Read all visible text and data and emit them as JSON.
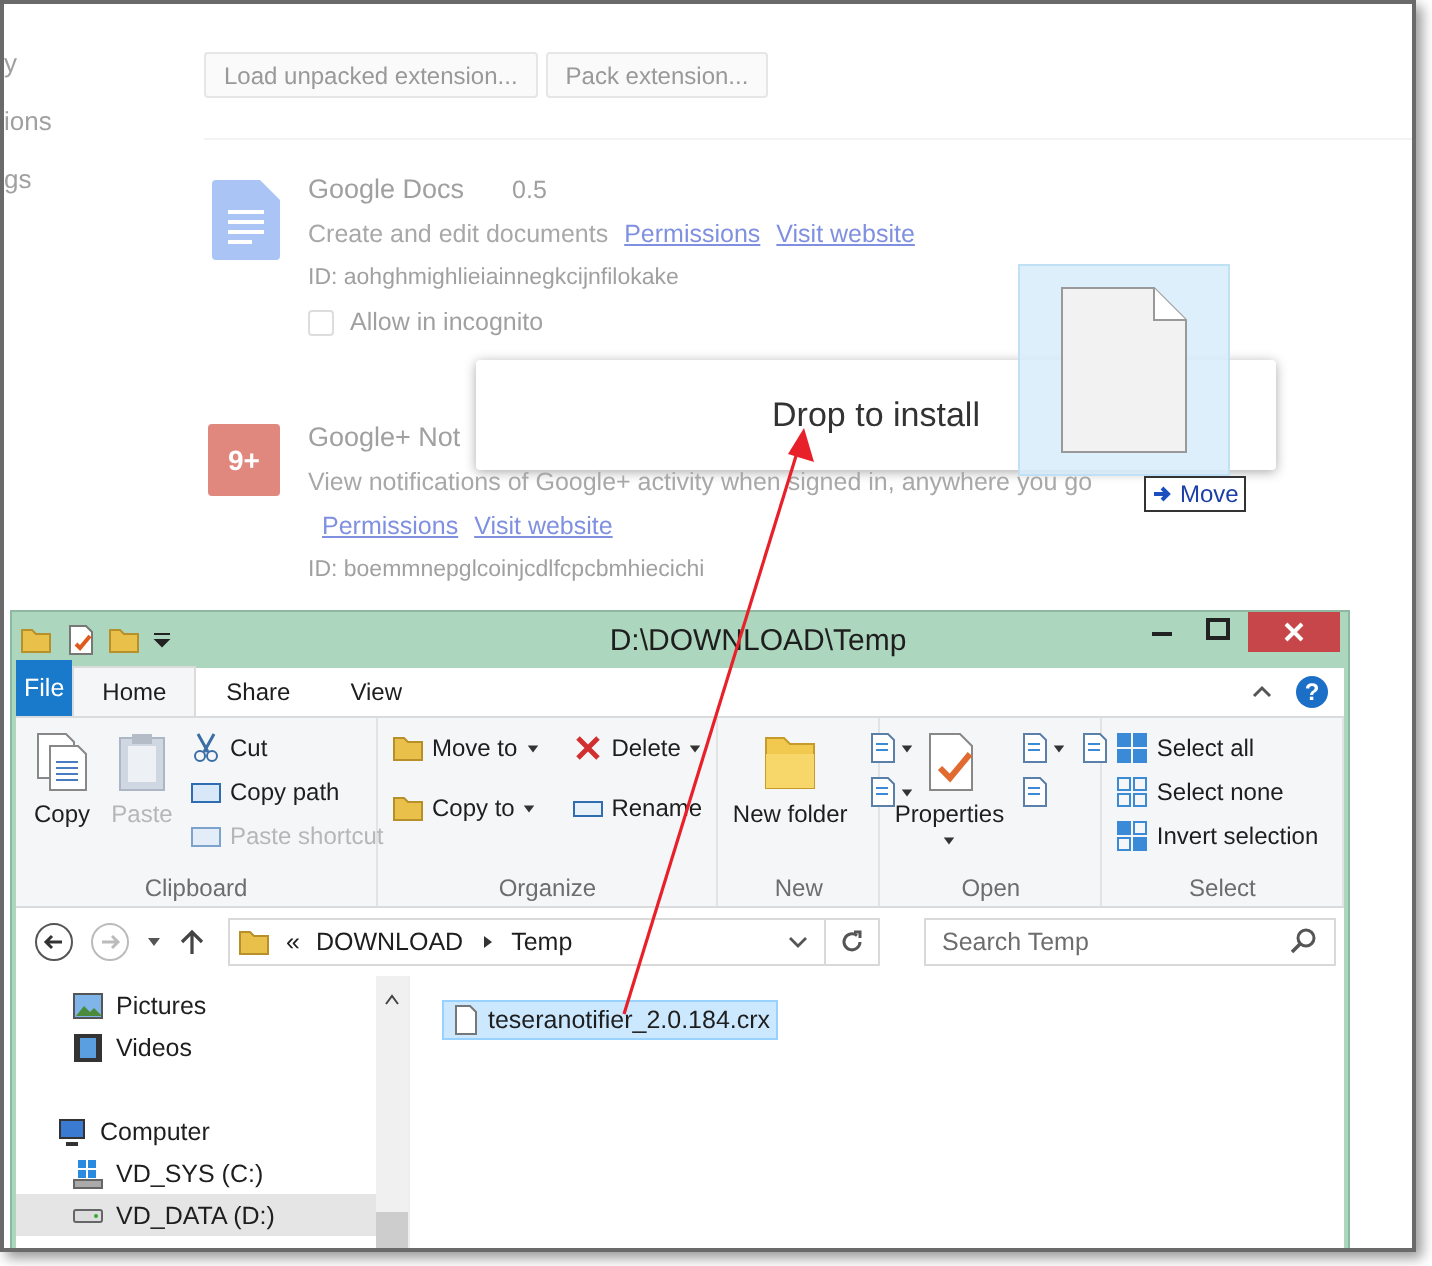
{
  "extensions_page": {
    "sidebar_items": [
      "y",
      "ions",
      "gs"
    ],
    "buttons": [
      "Load unpacked extension...",
      "Pack extension..."
    ],
    "extensions": [
      {
        "name": "Google Docs",
        "version": "0.5",
        "description": "Create and edit documents",
        "links": [
          "Permissions",
          "Visit website"
        ],
        "id": "ID: aohghmighlieiainnegkcijnfilokake",
        "incognito": {
          "label": "Allow in incognito",
          "checked": false
        }
      },
      {
        "name": "Google+ Not",
        "badge": "9+",
        "description": "View notifications of Google+ activity when signed in, anywhere you go",
        "links": [
          "Permissions",
          "Visit website"
        ],
        "id": "ID: boemmnepglcoinjcdlfcpcbmhiecichi"
      }
    ]
  },
  "drop_overlay": {
    "label": "Drop to install"
  },
  "drag": {
    "effect": "Move"
  },
  "explorer": {
    "title": "D:\\DOWNLOAD\\Temp",
    "help": "?",
    "tabs": [
      {
        "label": "File",
        "kind": "file",
        "selected": false
      },
      {
        "label": "Home",
        "kind": "tab",
        "selected": true
      },
      {
        "label": "Share",
        "kind": "tab",
        "selected": false
      },
      {
        "label": "View",
        "kind": "tab",
        "selected": false
      }
    ],
    "groups": [
      {
        "label": "Clipboard",
        "items": [
          {
            "label": "Copy",
            "kind": "large",
            "disabled": false
          },
          {
            "label": "Paste",
            "kind": "large",
            "disabled": true
          },
          {
            "label": "Cut",
            "kind": "small",
            "disabled": false
          },
          {
            "label": "Copy path",
            "kind": "small",
            "disabled": false
          },
          {
            "label": "Paste shortcut",
            "kind": "small",
            "disabled": true
          }
        ]
      },
      {
        "label": "Organize",
        "items": [
          {
            "label": "Move to",
            "kind": "small",
            "dropdown": true,
            "disabled": false
          },
          {
            "label": "Copy to",
            "kind": "small",
            "dropdown": true,
            "disabled": false
          },
          {
            "label": "Delete",
            "kind": "small",
            "dropdown": true,
            "disabled": false
          },
          {
            "label": "Rename",
            "kind": "small",
            "dropdown": false,
            "disabled": false
          }
        ]
      },
      {
        "label": "New",
        "items": [
          {
            "label": "New folder",
            "kind": "large",
            "dropdown": false,
            "disabled": false
          },
          {
            "kind": "iconbutton",
            "dropdown": true,
            "disabled": false
          },
          {
            "kind": "iconbutton",
            "dropdown": true,
            "disabled": false
          }
        ]
      },
      {
        "label": "Open",
        "items": [
          {
            "label": "Properties",
            "kind": "large",
            "dropdown": true,
            "disabled": false
          },
          {
            "kind": "iconbutton",
            "dropdown": true,
            "disabled": false
          },
          {
            "kind": "iconbutton",
            "dropdown": false,
            "disabled": false
          },
          {
            "kind": "iconbutton",
            "dropdown": false,
            "disabled": false
          }
        ]
      },
      {
        "label": "Select",
        "items": [
          {
            "label": "Select all",
            "kind": "small",
            "disabled": false
          },
          {
            "label": "Select none",
            "kind": "small",
            "disabled": false
          },
          {
            "label": "Invert selection",
            "kind": "small",
            "disabled": false
          }
        ]
      }
    ],
    "breadcrumb": {
      "overflow": "«",
      "parts": [
        "DOWNLOAD",
        "Temp"
      ]
    },
    "search": {
      "placeholder": "Search Temp"
    },
    "nav": [
      {
        "label": "Pictures",
        "kind": "pictures",
        "selected": false
      },
      {
        "label": "Videos",
        "kind": "videos",
        "selected": false
      },
      {
        "label": "Computer",
        "kind": "computer",
        "selected": false,
        "children": [
          {
            "label": "VD_SYS (C:)",
            "kind": "sysdrive",
            "selected": false
          },
          {
            "label": "VD_DATA (D:)",
            "kind": "drive",
            "selected": true
          }
        ]
      }
    ],
    "files": [
      {
        "name": "teseranotifier_2.0.184.crx",
        "selected": true
      }
    ]
  }
}
